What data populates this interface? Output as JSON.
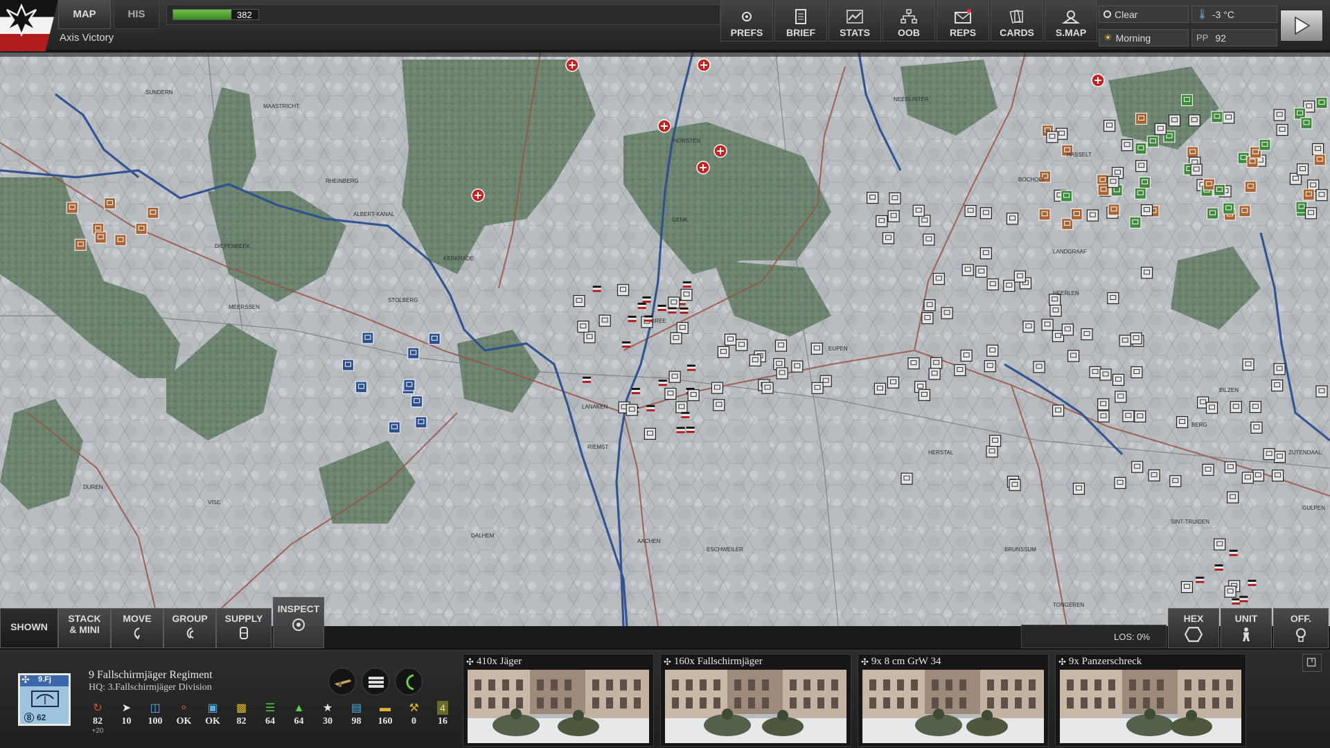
{
  "top": {
    "map_tab": "MAP",
    "his_tab": "HIS",
    "victory_status": "Axis Victory",
    "turn_value": "382",
    "turn_progress": 0.68,
    "tools": [
      {
        "id": "prefs",
        "label": "PREFS",
        "icon": "gear-icon"
      },
      {
        "id": "brief",
        "label": "BRIEF",
        "icon": "document-icon"
      },
      {
        "id": "stats",
        "label": "STATS",
        "icon": "chart-icon"
      },
      {
        "id": "oob",
        "label": "OOB",
        "icon": "hierarchy-icon"
      },
      {
        "id": "reps",
        "label": "REPS",
        "icon": "mail-icon"
      },
      {
        "id": "cards",
        "label": "CARDS",
        "icon": "cards-icon"
      },
      {
        "id": "smap",
        "label": "S.MAP",
        "icon": "strategic-map-icon"
      }
    ],
    "weather": "Clear",
    "temperature": "-3 °C",
    "daytime": "Morning",
    "pp_label": "PP",
    "pp_value": "92"
  },
  "map": {
    "place_names": [
      "SUNDERN",
      "RHEINBERG",
      "ALBERT-KANAL",
      "DIEPENBEEK",
      "HORSTEN",
      "GENK",
      "BREE",
      "BOCHOLT",
      "LANDGRAAF",
      "HEERLEN",
      "BRUNSSUM",
      "TONGEREN",
      "SINT-TRUIDEN",
      "BILZEN",
      "ZUTENDAAL",
      "HASSELT",
      "MAASTRICHT",
      "LANAKEN",
      "RIEMST",
      "VISE",
      "DALHEM",
      "AACHEN",
      "ESCHWEILER",
      "EUPEN",
      "HERSTAL",
      "BERG",
      "GULPEN",
      "STOLBERG",
      "DUREN",
      "MEERSSEN",
      "KERKRADE",
      "NEERLINTER"
    ]
  },
  "modes": {
    "shown": "SHOWN",
    "stack_line1": "STACK",
    "stack_line2": "& MINI",
    "move": "MOVE",
    "group": "GROUP",
    "supply": "SUPPLY",
    "inspect": "INSPECT",
    "los": "LOS: 0%",
    "hex": "HEX",
    "unit": "UNIT",
    "off": "OFF."
  },
  "unit": {
    "counter_label": "9.Fj",
    "strength": "8",
    "moves": "62",
    "name": "9 Fallschirmjäger Regiment",
    "hq": "HQ: 3.Fallschirmjäger Division",
    "stats": [
      {
        "icon": "movement-icon",
        "value": "82",
        "sub": "+20",
        "color": "#e04a2e"
      },
      {
        "icon": "attack-icon",
        "value": "10",
        "sub": "",
        "color": "#e8e8e8"
      },
      {
        "icon": "defense-icon",
        "value": "100",
        "sub": "",
        "color": "#4fb3e6"
      },
      {
        "icon": "hq-link-icon",
        "value": "OK",
        "sub": "",
        "color": "#e04a2e"
      },
      {
        "icon": "supply-link-icon",
        "value": "OK",
        "sub": "",
        "color": "#4fb3e6"
      },
      {
        "icon": "supply-icon",
        "value": "82",
        "sub": "",
        "color": "#e0b22e"
      },
      {
        "icon": "readiness-icon",
        "value": "64",
        "sub": "",
        "color": "#4fd34a"
      },
      {
        "icon": "morale-icon",
        "value": "64",
        "sub": "",
        "color": "#4fd34a"
      },
      {
        "icon": "experience-icon",
        "value": "30",
        "sub": "",
        "color": "#e8e8e8"
      },
      {
        "icon": "entrenchment-icon",
        "value": "98",
        "sub": "",
        "color": "#4fb3e6"
      },
      {
        "icon": "ammo-icon",
        "value": "160",
        "sub": "",
        "color": "#e0b22e"
      },
      {
        "icon": "repair-icon",
        "value": "0",
        "sub": "",
        "color": "#e0b22e"
      },
      {
        "icon": "level-icon",
        "value": "16",
        "sub": "",
        "color": "#e8e8e8",
        "badge": "4"
      }
    ],
    "subunits": [
      {
        "title": "410x Jäger"
      },
      {
        "title": "160x Fallschirmjäger"
      },
      {
        "title": "9x 8 cm GrW 34"
      },
      {
        "title": "9x Panzerschreck"
      }
    ]
  },
  "colors": {
    "axis_counter": "#a86432",
    "allied_counter": "#2c4f8e",
    "neutral_counter": "#e6e6e6",
    "green_counter": "#3e8a3a",
    "river": "#2c4f8e",
    "road": "#9a5240",
    "forest": "#5a7658",
    "snow": "#c8ccd0"
  }
}
